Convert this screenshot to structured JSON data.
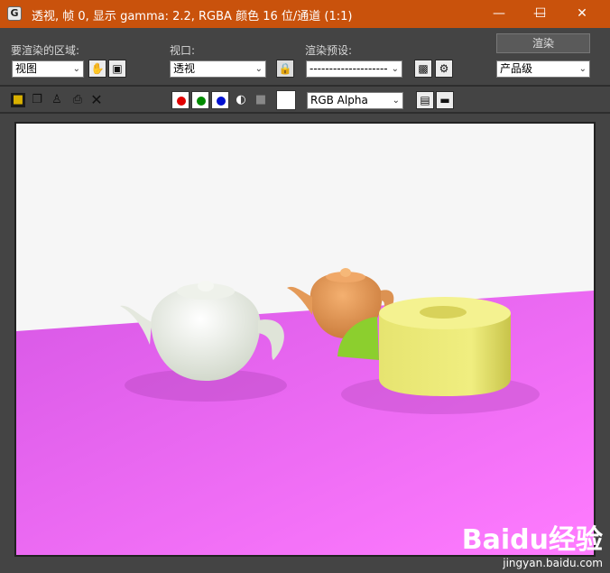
{
  "window": {
    "title": "透视, 帧 0, 显示 gamma: 2.2, RGBA 颜色 16 位/通道 (1:1)",
    "minimize": "—",
    "maximize": "☐",
    "close": "✕"
  },
  "toolbar": {
    "region_label": "要渲染的区域:",
    "region_value": "视图",
    "viewport_label": "视口:",
    "viewport_value": "透视",
    "preset_label": "渲染预设:",
    "preset_value": "--------------------",
    "render_button": "渲染",
    "quality_value": "产品级",
    "channel_value": "RGB Alpha"
  },
  "colors": {
    "titlebar": "#c9520c",
    "floor": "#f05cf0",
    "background": "#f6f6f6"
  },
  "watermark": {
    "logo": "Baidu经验",
    "url": "jingyan.baidu.com"
  }
}
